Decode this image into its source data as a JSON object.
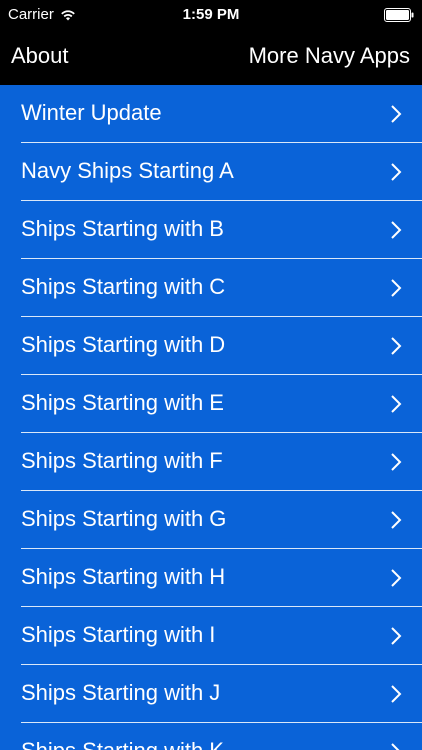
{
  "status": {
    "carrier": "Carrier",
    "time": "1:59 PM"
  },
  "nav": {
    "left_label": "About",
    "right_label": "More Navy Apps"
  },
  "list": {
    "items": [
      {
        "label": "Winter Update"
      },
      {
        "label": "Navy Ships Starting A"
      },
      {
        "label": "Ships Starting with B"
      },
      {
        "label": "Ships Starting with C"
      },
      {
        "label": "Ships Starting with D"
      },
      {
        "label": "Ships Starting with E"
      },
      {
        "label": "Ships Starting with F"
      },
      {
        "label": "Ships Starting with G"
      },
      {
        "label": "Ships Starting with H"
      },
      {
        "label": "Ships Starting with I"
      },
      {
        "label": "Ships Starting with J"
      },
      {
        "label": "Ships Starting with K"
      }
    ]
  },
  "colors": {
    "background": "#0a63d8",
    "bar": "#000000",
    "text": "#ffffff"
  },
  "icons": {
    "wifi": "wifi-icon",
    "battery": "battery-icon",
    "chevron": "chevron-right-icon"
  }
}
